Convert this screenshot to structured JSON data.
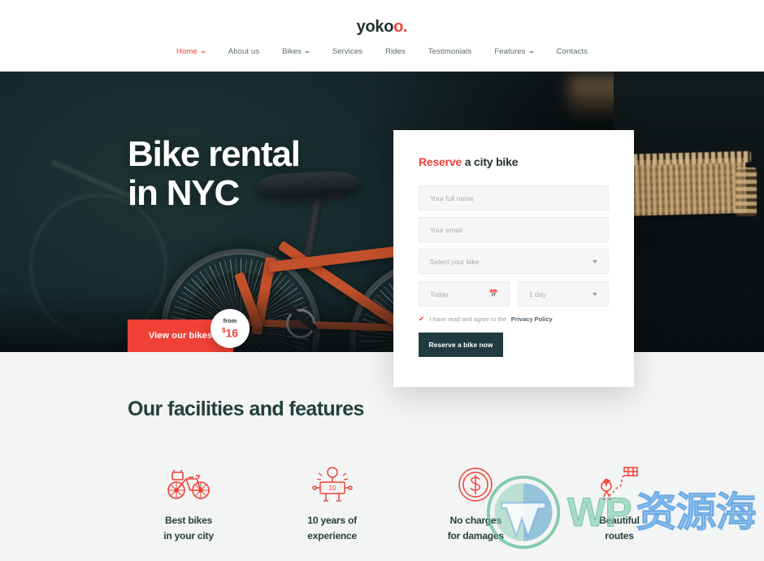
{
  "header": {
    "logo_text": "yoko",
    "logo_accent": "o.",
    "nav": [
      {
        "label": "Home",
        "active": true,
        "has_dropdown": true
      },
      {
        "label": "About us",
        "active": false,
        "has_dropdown": false
      },
      {
        "label": "Bikes",
        "active": false,
        "has_dropdown": true
      },
      {
        "label": "Services",
        "active": false,
        "has_dropdown": false
      },
      {
        "label": "Rides",
        "active": false,
        "has_dropdown": false
      },
      {
        "label": "Testimonials",
        "active": false,
        "has_dropdown": false
      },
      {
        "label": "Features",
        "active": false,
        "has_dropdown": true
      },
      {
        "label": "Contacts",
        "active": false,
        "has_dropdown": false
      }
    ]
  },
  "hero": {
    "title_line1": "Bike rental",
    "title_line2": "in NYC",
    "cta_label": "View our bikes",
    "badge_from": "from",
    "badge_currency": "$",
    "badge_price": "16"
  },
  "reserve": {
    "title_accent": "Reserve",
    "title_rest": " a city bike",
    "full_name_placeholder": "Your full name",
    "email_placeholder": "Your email",
    "bike_select_value": "Select your bike",
    "date_value": "Today",
    "date_icon": "calendar-icon",
    "duration_value": "1 day",
    "agree_check": "✔",
    "agree_text": "I have read and agree to the ",
    "agree_link": "Privacy Policy",
    "submit_label": "Reserve a bike now"
  },
  "features": {
    "section_title": "Our facilities and features",
    "items": [
      {
        "icon": "bicycle-icon",
        "label": "Best bikes\nin your city"
      },
      {
        "icon": "experience-badge-icon",
        "label": "10 years of\nexperience",
        "icon_number": "10"
      },
      {
        "icon": "dollar-coin-icon",
        "label": "No charges\nfor damages"
      },
      {
        "icon": "route-map-icon",
        "label": "Beautiful\nroutes"
      }
    ]
  },
  "watermark": {
    "logo": "wordpress-icon",
    "text_latin": "WP",
    "text_cjk": "资源海"
  },
  "colors": {
    "accent_red": "#ef4136",
    "dark_teal": "#22403c",
    "navy_button": "#1f3b3f",
    "field_bg": "#f6f6f7",
    "section_bg": "#f3f4f4"
  }
}
